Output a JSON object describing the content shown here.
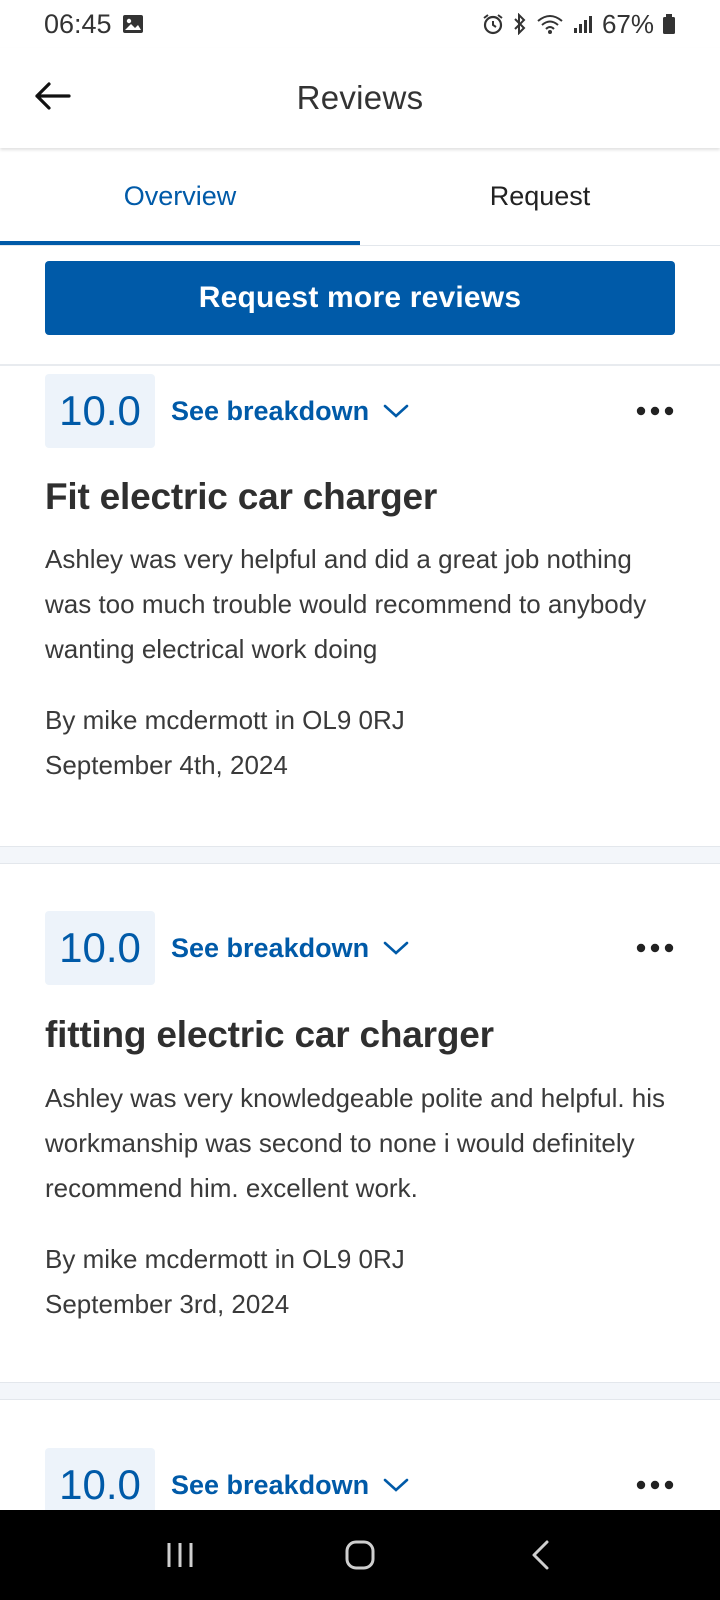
{
  "status_bar": {
    "time": "06:45",
    "battery": "67%",
    "icons": [
      "image-icon",
      "alarm-icon",
      "bluetooth-icon",
      "wifi-icon",
      "signal-icon",
      "battery-icon"
    ]
  },
  "app_bar": {
    "title": "Reviews",
    "back_icon": "back-arrow-icon"
  },
  "tabs": [
    {
      "label": "Overview",
      "active": true
    },
    {
      "label": "Request",
      "active": false
    }
  ],
  "request_button": {
    "label": "Request more reviews"
  },
  "colors": {
    "brand": "#005aa8",
    "score_bg": "#edf3fa",
    "divider_bg": "#f3f6fa",
    "nav_bar": "#000000"
  },
  "reviews": [
    {
      "score": "10.0",
      "breakdown_label": "See breakdown",
      "title": "Fit electric car charger",
      "body": "Ashley was very helpful and did a great job nothing was too much trouble would recommend to anybody wanting electrical work doing",
      "author": "By mike mcdermott in OL9 0RJ",
      "date": "September 4th, 2024"
    },
    {
      "score": "10.0",
      "breakdown_label": "See breakdown",
      "title": "fitting electric car charger",
      "body": "Ashley was very knowledgeable polite and helpful. his workmanship was second to none i would definitely recommend him. excellent work.",
      "author": "By mike mcdermott in OL9 0RJ",
      "date": "September 3rd, 2024"
    },
    {
      "score": "10.0",
      "breakdown_label": "See breakdown"
    }
  ],
  "nav_bar": {
    "buttons": [
      "recent-apps-icon",
      "home-icon",
      "back-icon"
    ]
  }
}
